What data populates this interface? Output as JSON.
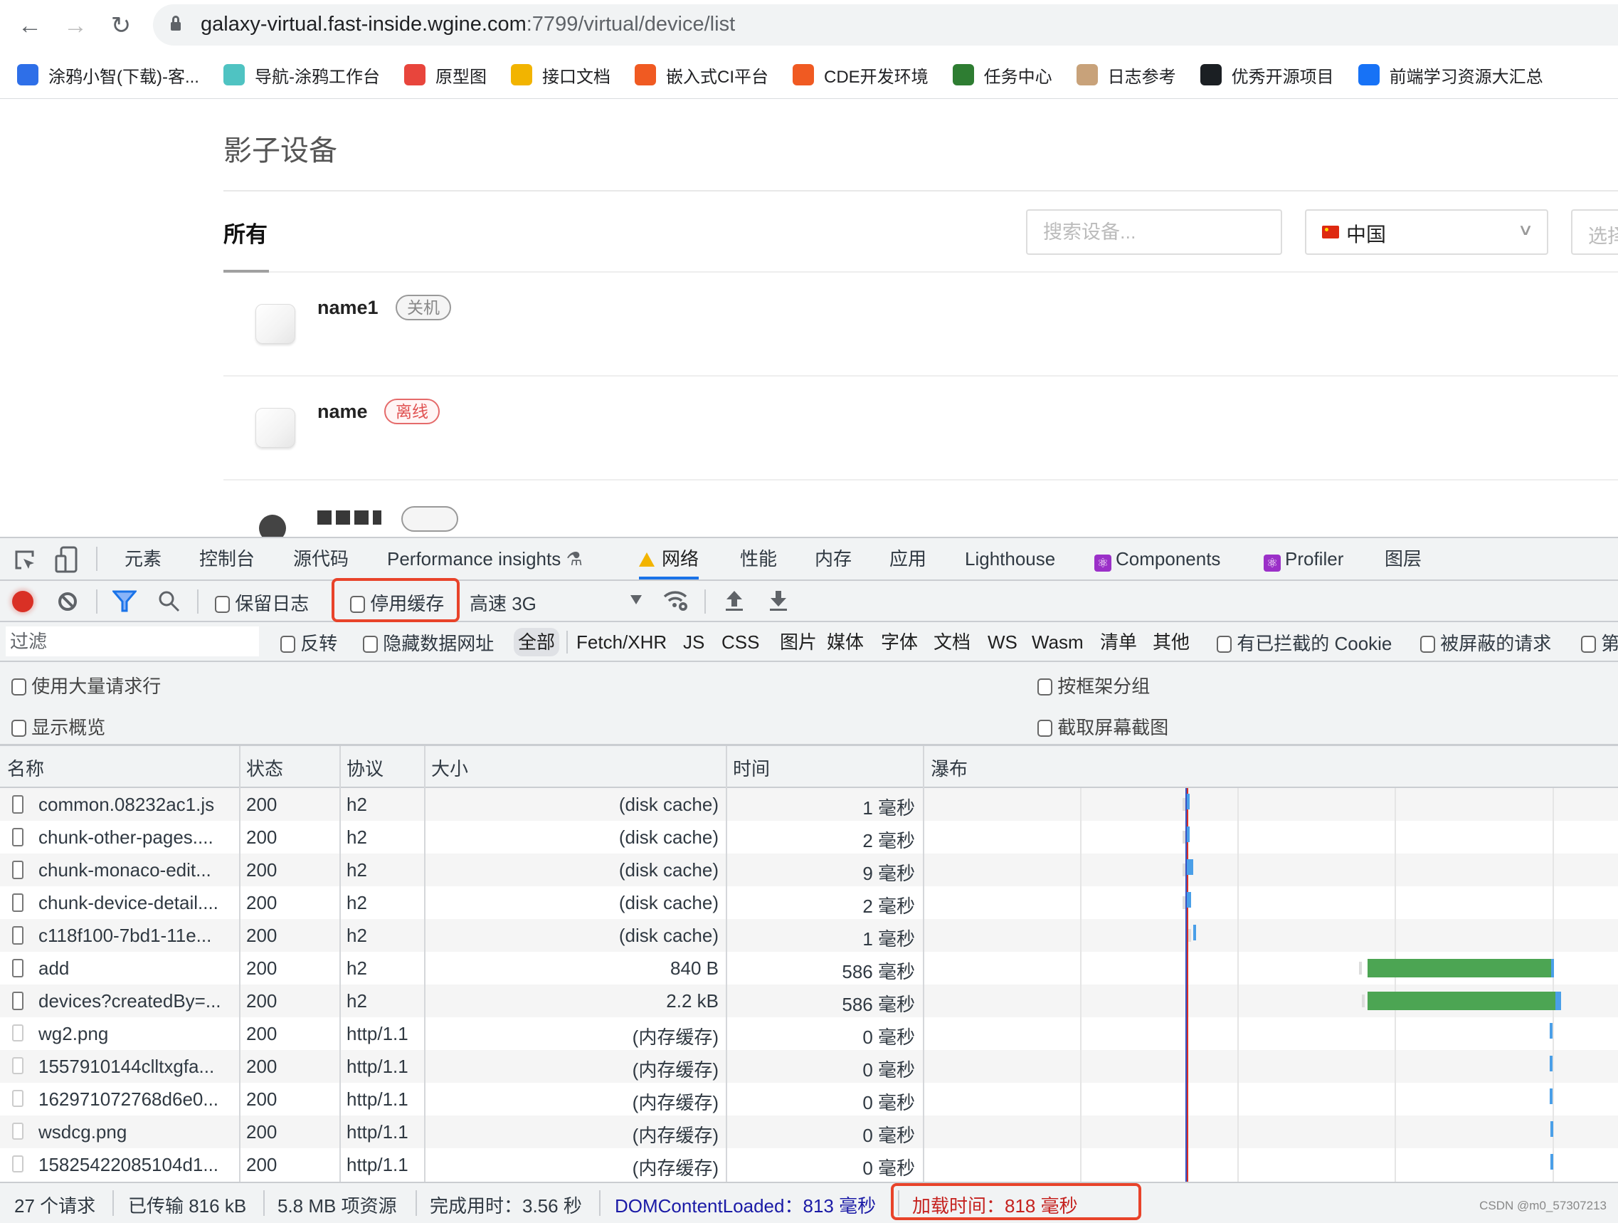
{
  "browser": {
    "url_host": "galaxy-virtual.fast-inside.wgine.com",
    "url_path": ":7799/virtual/device/list",
    "bookmarks": [
      {
        "label": "涂鸦小智(下载)-客...",
        "icon": "tuya-xiaozhi-icon",
        "color": "#2e6fe8"
      },
      {
        "label": "导航-涂鸦工作台",
        "icon": "home-icon",
        "color": "#4fc3c2"
      },
      {
        "label": "原型图",
        "icon": "prototype-icon",
        "color": "#e8453c"
      },
      {
        "label": "接口文档",
        "icon": "yapi-icon",
        "color": "#f2b400"
      },
      {
        "label": "嵌入式CI平台",
        "icon": "tuya-t-icon",
        "color": "#f05a22"
      },
      {
        "label": "CDE开发环境",
        "icon": "tuya-t-icon",
        "color": "#f05a22"
      },
      {
        "label": "任务中心",
        "icon": "task-center-icon",
        "color": "#2e7d32"
      },
      {
        "label": "日志参考",
        "icon": "jenkins-icon",
        "color": "#c8a27a"
      },
      {
        "label": "优秀开源项目",
        "icon": "github-icon",
        "color": "#1b1f23"
      },
      {
        "label": "前端学习资源大汇总",
        "icon": "zhihu-icon",
        "color": "#1772f6"
      }
    ]
  },
  "page": {
    "title": "影子设备",
    "tab_all": "所有",
    "search_placeholder": "搜索设备...",
    "country_value": "中国",
    "third_select_placeholder": "选择",
    "devices": [
      {
        "name": "name1",
        "status": "关机",
        "status_kind": "off"
      },
      {
        "name": "name",
        "status": "离线",
        "status_kind": "offline"
      }
    ]
  },
  "devtools": {
    "tabs": [
      "元素",
      "控制台",
      "源代码",
      "Performance insights",
      "网络",
      "性能",
      "内存",
      "应用",
      "Lighthouse",
      "Components",
      "Profiler",
      "图层"
    ],
    "active_tab": "网络",
    "toolbar": {
      "preserve_log": "保留日志",
      "disable_cache": "停用缓存",
      "throttling": "高速 3G"
    },
    "filter": {
      "placeholder": "过滤",
      "invert": "反转",
      "hide_data_urls": "隐藏数据网址",
      "types": [
        "全部",
        "Fetch/XHR",
        "JS",
        "CSS",
        "图片",
        "媒体",
        "字体",
        "文档",
        "WS",
        "Wasm",
        "清单",
        "其他"
      ],
      "selected_type": "全部",
      "blocked_cookies": "有已拦截的 Cookie",
      "blocked_requests": "被屏蔽的请求",
      "third_party": "第"
    },
    "options": {
      "large_rows": "使用大量请求行",
      "group_by_frame": "按框架分组",
      "show_overview": "显示概览",
      "capture_screenshots": "截取屏幕截图"
    },
    "columns": [
      "名称",
      "状态",
      "协议",
      "大小",
      "时间",
      "瀑布"
    ],
    "requests": [
      {
        "name": "common.08232ac1.js",
        "status": "200",
        "protocol": "h2",
        "size": "(disk cache)",
        "time": "1 毫秒"
      },
      {
        "name": "chunk-other-pages....",
        "status": "200",
        "protocol": "h2",
        "size": "(disk cache)",
        "time": "2 毫秒"
      },
      {
        "name": "chunk-monaco-edit...",
        "status": "200",
        "protocol": "h2",
        "size": "(disk cache)",
        "time": "9 毫秒"
      },
      {
        "name": "chunk-device-detail....",
        "status": "200",
        "protocol": "h2",
        "size": "(disk cache)",
        "time": "2 毫秒"
      },
      {
        "name": "c118f100-7bd1-11e...",
        "status": "200",
        "protocol": "h2",
        "size": "(disk cache)",
        "time": "1 毫秒"
      },
      {
        "name": "add",
        "status": "200",
        "protocol": "h2",
        "size": "840 B",
        "time": "586 毫秒"
      },
      {
        "name": "devices?createdBy=...",
        "status": "200",
        "protocol": "h2",
        "size": "2.2 kB",
        "time": "586 毫秒"
      },
      {
        "name": "wg2.png",
        "status": "200",
        "protocol": "http/1.1",
        "size": "(内存缓存)",
        "time": "0 毫秒"
      },
      {
        "name": "1557910144clltxgfa...",
        "status": "200",
        "protocol": "http/1.1",
        "size": "(内存缓存)",
        "time": "0 毫秒"
      },
      {
        "name": "162971072768d6e0...",
        "status": "200",
        "protocol": "http/1.1",
        "size": "(内存缓存)",
        "time": "0 毫秒"
      },
      {
        "name": "wsdcg.png",
        "status": "200",
        "protocol": "http/1.1",
        "size": "(内存缓存)",
        "time": "0 毫秒"
      },
      {
        "name": "15825422085104d1...",
        "status": "200",
        "protocol": "http/1.1",
        "size": "(内存缓存)",
        "time": "0 毫秒"
      }
    ],
    "status_bar": {
      "requests": "27 个请求",
      "transferred": "已传输 816 kB",
      "resources": "5.8 MB 项资源",
      "finish": "完成用时：3.56 秒",
      "dom_content_loaded": "DOMContentLoaded：813 毫秒",
      "load": "加载时间：818 毫秒"
    },
    "colors": {
      "accent": "#1a73e8",
      "highlight_box": "#e8432a",
      "waterfall_waiting": "#4ca553",
      "waterfall_download": "#4a9fe8"
    }
  },
  "watermark": "CSDN @m0_57307213"
}
